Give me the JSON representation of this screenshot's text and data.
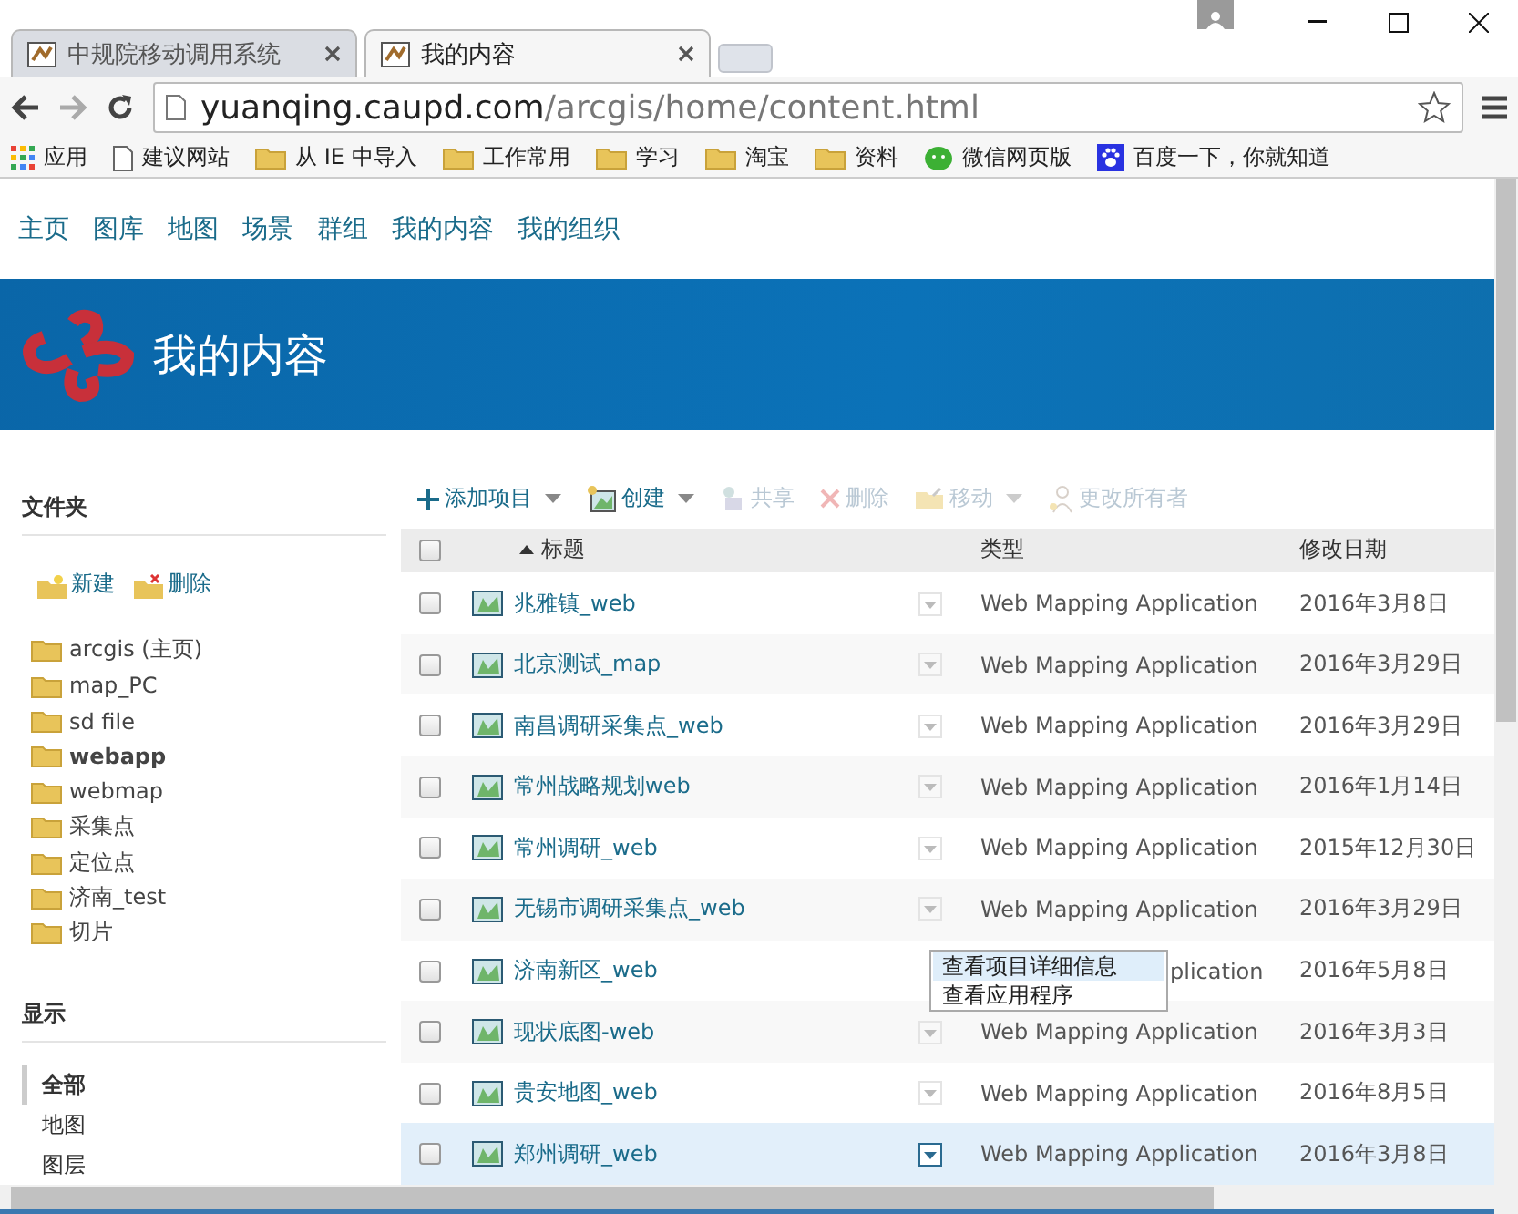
{
  "browser": {
    "tabs": [
      {
        "title": "中规院移动调用系统",
        "selected": false
      },
      {
        "title": "我的内容",
        "selected": true
      }
    ],
    "address": {
      "host": "yuanqing.caupd.com",
      "path": "/arcgis/home/content.html"
    },
    "bookmarks": [
      {
        "kind": "apps",
        "label": "应用"
      },
      {
        "kind": "page",
        "label": "建议网站"
      },
      {
        "kind": "folder",
        "label": "从 IE 中导入"
      },
      {
        "kind": "folder",
        "label": "工作常用"
      },
      {
        "kind": "folder",
        "label": "学习"
      },
      {
        "kind": "folder",
        "label": "淘宝"
      },
      {
        "kind": "folder",
        "label": "资料"
      },
      {
        "kind": "chat",
        "label": "微信网页版"
      },
      {
        "kind": "paw",
        "label": "百度一下，你就知道"
      }
    ]
  },
  "nav": [
    "主页",
    "图库",
    "地图",
    "场景",
    "群组",
    "我的内容",
    "我的组织"
  ],
  "banner": {
    "title": "我的内容"
  },
  "sidebar": {
    "folders_heading": "文件夹",
    "folder_actions": [
      {
        "kind": "new",
        "label": "新建"
      },
      {
        "kind": "delete",
        "label": "删除"
      }
    ],
    "folders": [
      {
        "label": "arcgis (主页)",
        "selected": false
      },
      {
        "label": "map_PC",
        "selected": false
      },
      {
        "label": "sd file",
        "selected": false
      },
      {
        "label": "webapp",
        "selected": true
      },
      {
        "label": "webmap",
        "selected": false
      },
      {
        "label": "采集点",
        "selected": false
      },
      {
        "label": "定位点",
        "selected": false
      },
      {
        "label": "济南_test",
        "selected": false
      },
      {
        "label": "切片",
        "selected": false
      }
    ],
    "show_heading": "显示",
    "filters": [
      {
        "label": "全部",
        "selected": true
      },
      {
        "label": "地图",
        "selected": false
      },
      {
        "label": "图层",
        "selected": false
      }
    ]
  },
  "toolbar": [
    {
      "kind": "add",
      "label": "添加项目",
      "dropdown": true,
      "disabled": false
    },
    {
      "kind": "create",
      "label": "创建",
      "dropdown": true,
      "disabled": false
    },
    {
      "kind": "share",
      "label": "共享",
      "dropdown": false,
      "disabled": true
    },
    {
      "kind": "delete",
      "label": "删除",
      "dropdown": false,
      "disabled": true
    },
    {
      "kind": "move",
      "label": "移动",
      "dropdown": true,
      "disabled": true
    },
    {
      "kind": "owner",
      "label": "更改所有者",
      "dropdown": false,
      "disabled": true
    }
  ],
  "table": {
    "columns": [
      "标题",
      "类型",
      "修改日期"
    ],
    "all_checked": false,
    "rows": [
      {
        "title": "兆雅镇_web",
        "type": "Web Mapping Application",
        "date": "2016年3月8日",
        "checked": false,
        "selected": false
      },
      {
        "title": "北京测试_map",
        "type": "Web Mapping Application",
        "date": "2016年3月29日",
        "checked": false,
        "selected": false
      },
      {
        "title": "南昌调研采集点_web",
        "type": "Web Mapping Application",
        "date": "2016年3月29日",
        "checked": false,
        "selected": false
      },
      {
        "title": "常州战略规划web",
        "type": "Web Mapping Application",
        "date": "2016年1月14日",
        "checked": false,
        "selected": false
      },
      {
        "title": "常州调研_web",
        "type": "Web Mapping Application",
        "date": "2015年12月30日",
        "checked": false,
        "selected": false
      },
      {
        "title": "无锡市调研采集点_web",
        "type": "Web Mapping Application",
        "date": "2016年3月29日",
        "checked": false,
        "selected": false
      },
      {
        "title": "济南新区_web",
        "type": "plication",
        "date": "2016年5月8日",
        "checked": false,
        "selected": false,
        "context_menu": {
          "items": [
            {
              "label": "查看项目详细信息",
              "selected": true
            },
            {
              "label": "查看应用程序",
              "selected": false
            }
          ]
        }
      },
      {
        "title": "现状底图-web",
        "type": "Web Mapping Application",
        "date": "2016年3月3日",
        "checked": false,
        "selected": false
      },
      {
        "title": "贵安地图_web",
        "type": "Web Mapping Application",
        "date": "2016年8月5日",
        "checked": false,
        "selected": false
      },
      {
        "title": "郑州调研_web",
        "type": "Web Mapping Application",
        "date": "2016年3月8日",
        "checked": false,
        "selected": true
      }
    ]
  }
}
